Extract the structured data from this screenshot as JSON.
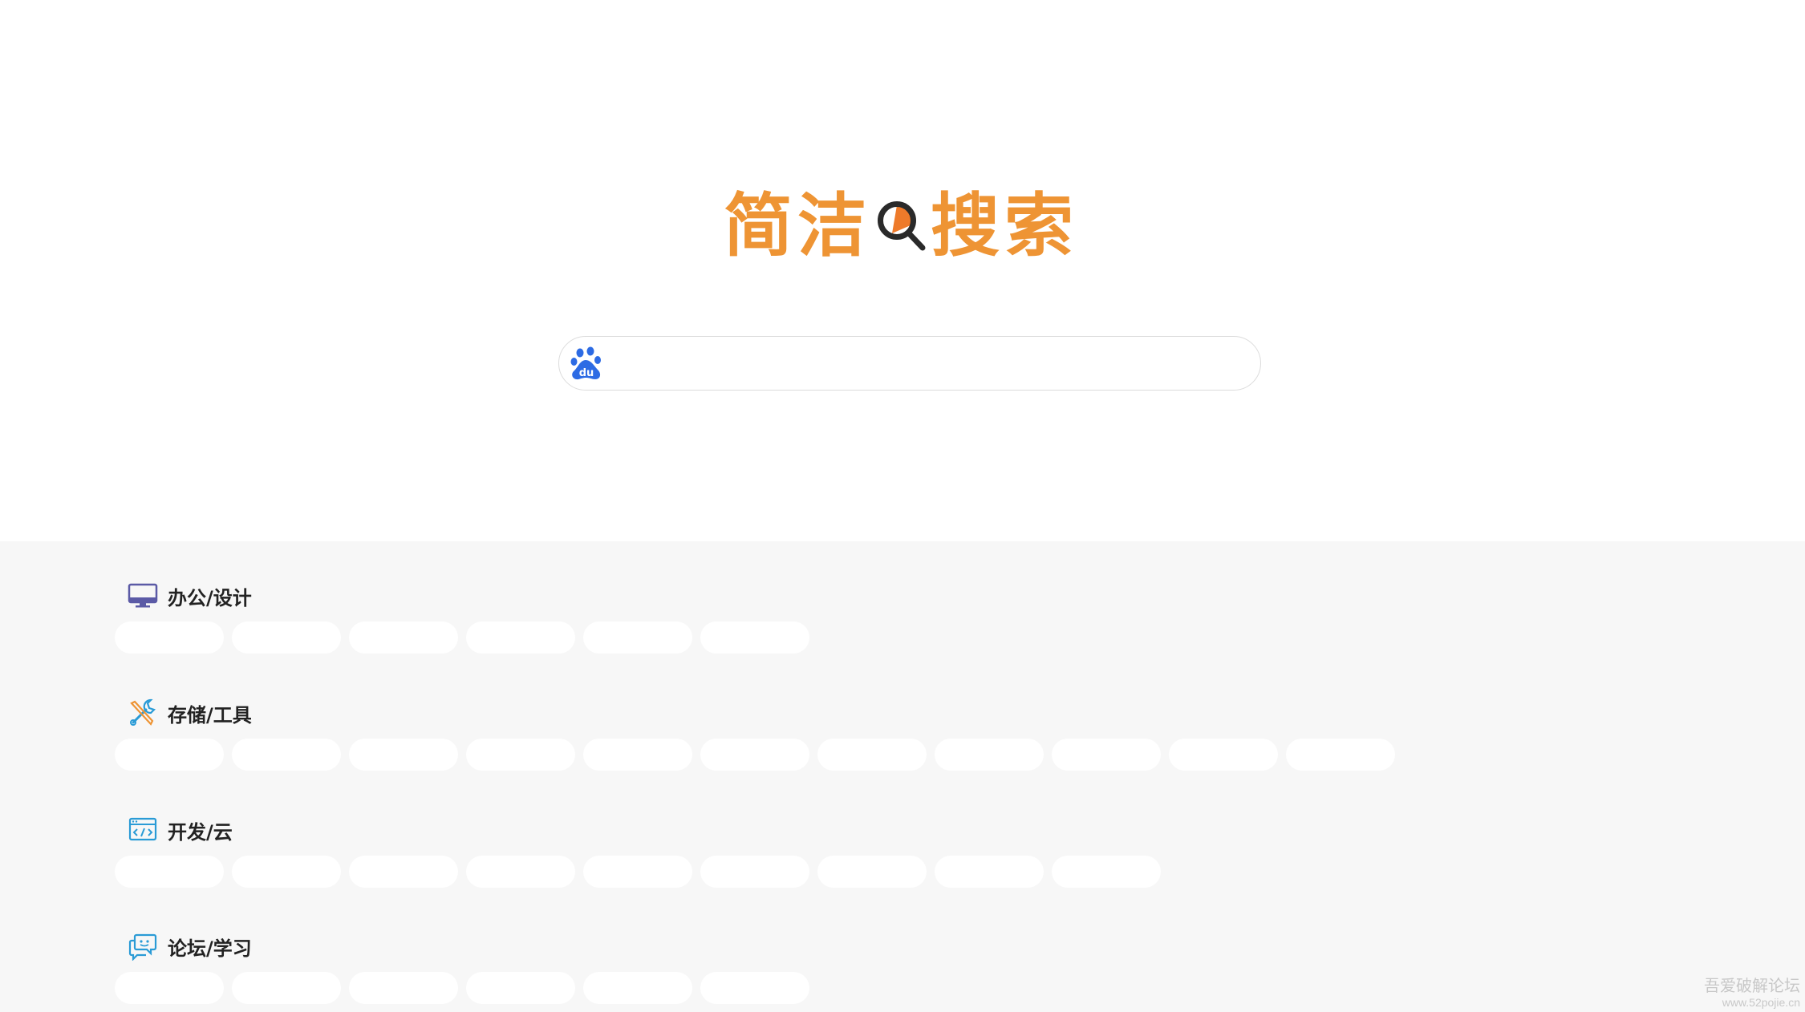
{
  "header": {
    "logo_text_left": "简洁",
    "logo_text_right": "搜索",
    "logo_color": "#ee9434"
  },
  "search": {
    "engine_icon": "baidu-paw-icon",
    "value": "",
    "placeholder": ""
  },
  "categories": [
    {
      "title": "办公/设计",
      "icon": "monitor-icon",
      "link_count": 6
    },
    {
      "title": "存储/工具",
      "icon": "tools-icon",
      "link_count": 11
    },
    {
      "title": "开发/云",
      "icon": "code-window-icon",
      "link_count": 9
    },
    {
      "title": "论坛/学习",
      "icon": "chat-bubbles-icon",
      "link_count": 6
    }
  ],
  "watermark": {
    "line1": "吾爱破解论坛",
    "line2": "www.52pojie.cn"
  },
  "colors": {
    "accent": "#ee9434",
    "baidu_blue": "#2d6be4",
    "content_bg": "#f7f7f7"
  }
}
